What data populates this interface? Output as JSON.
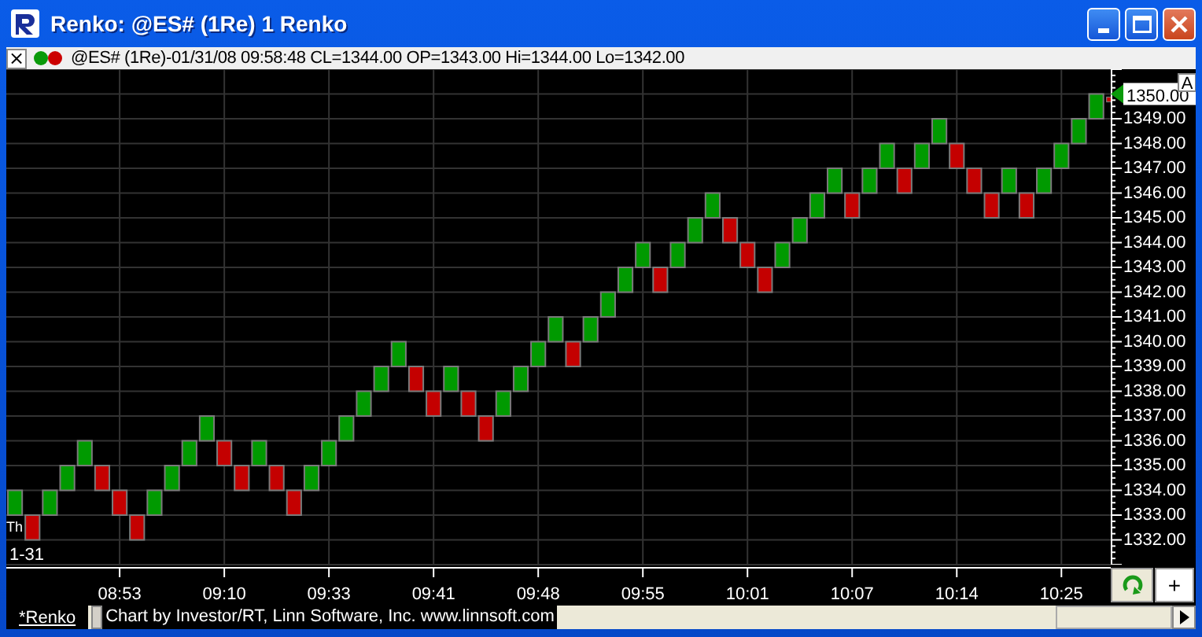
{
  "window": {
    "title": "Renko: @ES# (1Re) 1 Renko"
  },
  "info_bar": {
    "close": "×",
    "text": "@ES# (1Re)-01/31/08 09:58:48 CL=1344.00 OP=1343.00 Hi=1344.00 Lo=1342.00"
  },
  "chart": {
    "day_label": "Th",
    "date_label": "1-31",
    "last_price": "1350.00",
    "autoscale": "A",
    "chart_data": {
      "type": "scatter",
      "categories": [
        null,
        null,
        null,
        null,
        null,
        null,
        "08:53",
        null,
        null,
        null,
        null,
        null,
        "09:10",
        null,
        null,
        null,
        null,
        null,
        "09:33",
        null,
        null,
        null,
        null,
        null,
        "09:41",
        null,
        null,
        null,
        null,
        null,
        "09:48",
        null,
        null,
        null,
        null,
        null,
        "09:55",
        null,
        null,
        null,
        null,
        null,
        "10:01",
        null,
        null,
        null,
        null,
        null,
        "10:07",
        null,
        null,
        null,
        null,
        null,
        "10:14",
        null,
        null,
        null,
        null,
        null,
        "10:25",
        null,
        null
      ],
      "ylim": [
        1331,
        1351
      ],
      "grid": true,
      "series": [
        {
          "color": "#009a00",
          "values": [
            1333.5,
            null,
            1333.5,
            1334.5,
            1335.5,
            null,
            null,
            null,
            1333.5,
            1334.5,
            1335.5,
            1336.5,
            null,
            null,
            1335.5,
            null,
            null,
            1334.5,
            1335.5,
            1336.5,
            1337.5,
            1338.5,
            1339.5,
            null,
            null,
            1338.5,
            null,
            null,
            1337.5,
            1338.5,
            1339.5,
            1340.5,
            null,
            1340.5,
            1341.5,
            1342.5,
            1343.5,
            null,
            1343.5,
            1344.5,
            1345.5,
            null,
            null,
            null,
            1343.5,
            1344.5,
            1345.5,
            1346.5,
            null,
            1346.5,
            1347.5,
            null,
            1347.5,
            1348.5,
            null,
            null,
            null,
            1346.5,
            null,
            1346.5,
            1347.5,
            1348.5,
            1349.5
          ]
        },
        {
          "color": "#c40000",
          "values": [
            null,
            1332.5,
            null,
            null,
            null,
            1334.5,
            1333.5,
            1332.5,
            null,
            null,
            null,
            null,
            1335.5,
            1334.5,
            null,
            1334.5,
            1333.5,
            null,
            null,
            null,
            null,
            null,
            null,
            1338.5,
            1337.5,
            null,
            1337.5,
            1336.5,
            null,
            null,
            null,
            null,
            1339.5,
            null,
            null,
            null,
            null,
            1342.5,
            null,
            null,
            null,
            1344.5,
            1343.5,
            1342.5,
            null,
            null,
            null,
            null,
            1345.5,
            null,
            null,
            1346.5,
            null,
            null,
            1347.5,
            1346.5,
            1345.5,
            null,
            1345.5,
            null,
            null,
            null,
            null
          ]
        }
      ],
      "yticks": [
        {
          "value": 1332,
          "label": "1332.00"
        },
        {
          "value": 1333,
          "label": "1333.00"
        },
        {
          "value": 1334,
          "label": "1334.00"
        },
        {
          "value": 1335,
          "label": "1335.00"
        },
        {
          "value": 1336,
          "label": "1336.00"
        },
        {
          "value": 1337,
          "label": "1337.00"
        },
        {
          "value": 1338,
          "label": "1338.00"
        },
        {
          "value": 1339,
          "label": "1339.00"
        },
        {
          "value": 1340,
          "label": "1340.00"
        },
        {
          "value": 1341,
          "label": "1341.00"
        },
        {
          "value": 1342,
          "label": "1342.00"
        },
        {
          "value": 1343,
          "label": "1343.00"
        },
        {
          "value": 1344,
          "label": "1344.00"
        },
        {
          "value": 1345,
          "label": "1345.00"
        },
        {
          "value": 1346,
          "label": "1346.00"
        },
        {
          "value": 1347,
          "label": "1347.00"
        },
        {
          "value": 1348,
          "label": "1348.00"
        },
        {
          "value": 1349,
          "label": "1349.00"
        }
      ]
    }
  },
  "zoom_button": "+",
  "tabs": [
    {
      "label": "*Renko",
      "selected": true
    }
  ],
  "credit": "Chart by Investor/RT, Linn Software, Inc. www.linnsoft.com"
}
